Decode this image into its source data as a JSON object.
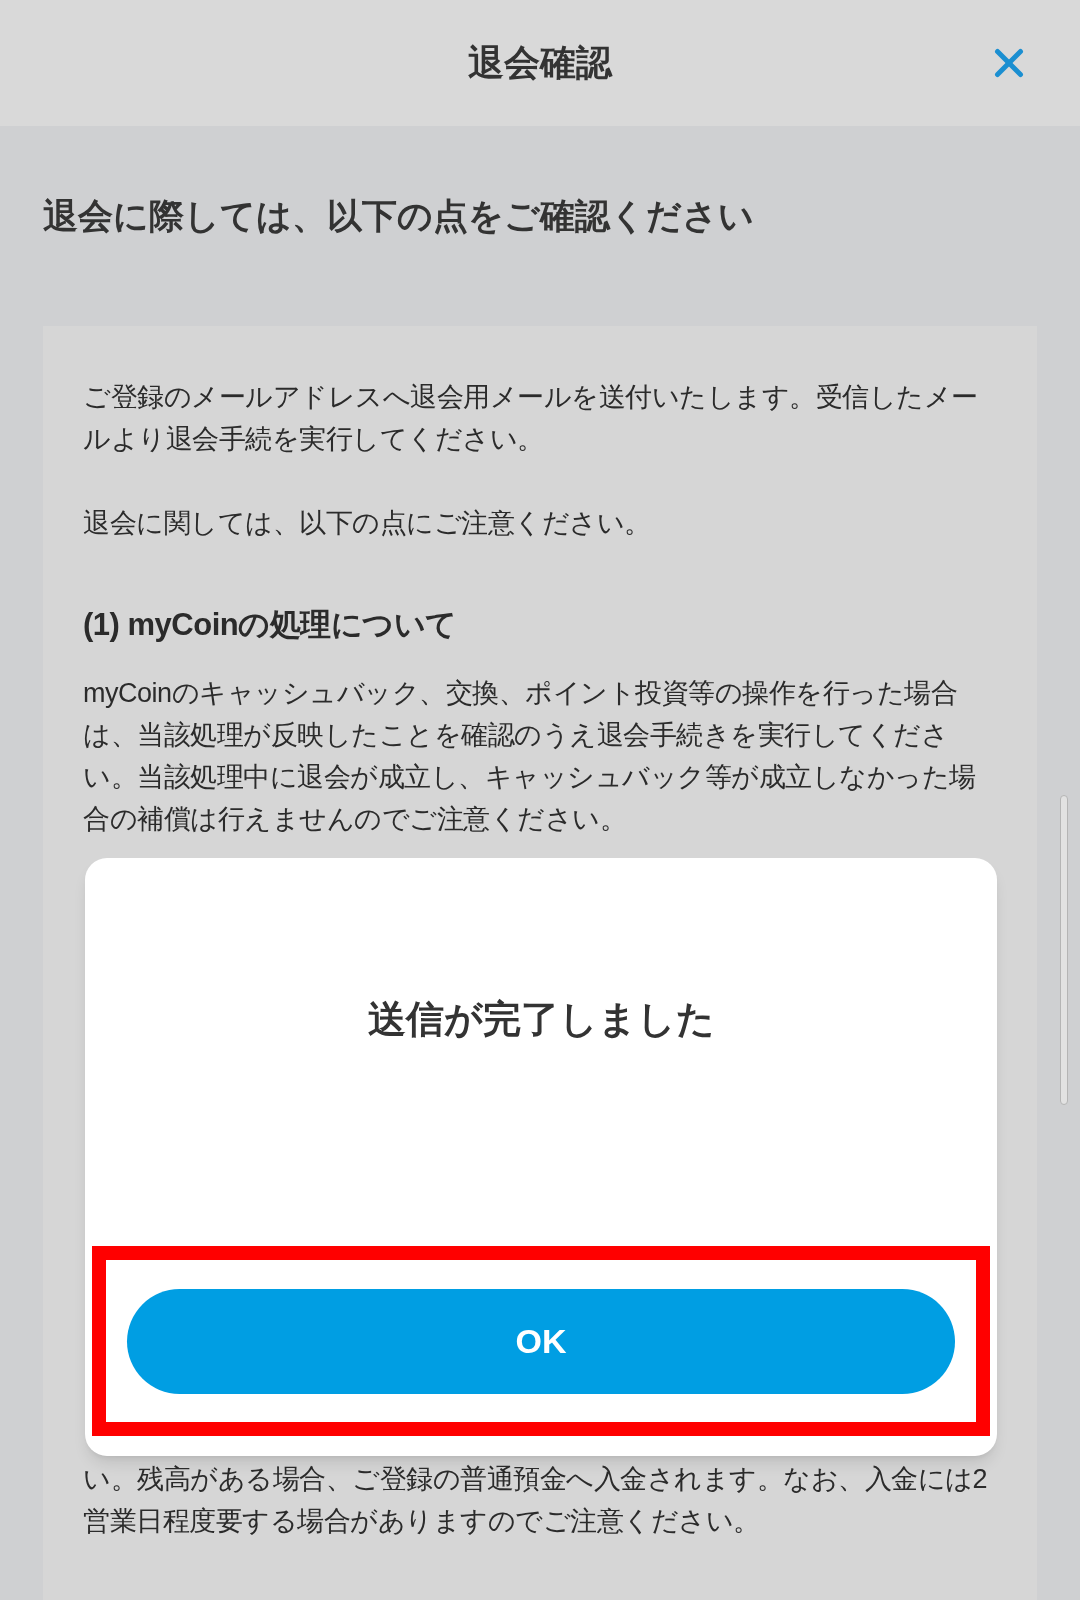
{
  "header": {
    "title": "退会確認"
  },
  "heading": "退会に際しては、以下の点をご確認ください",
  "notice": {
    "paragraphs": [
      "ご登録のメールアドレスへ退会用メールを送付いたします。受信したメールより退会手続を実行してください。",
      "退会に関しては、以下の点にご注意ください。"
    ],
    "section_title": "(1) myCoinの処理について",
    "section_body": "myCoinのキャッシュバック、交換、ポイント投資等の操作を行った場合は、当該処理が反映したことを確認のうえ退会手続きを実行してください。当該処理中に退会が成立し、キャッシュバック等が成立しなかった場合の補償は行えませんのでご注意ください。",
    "trailing_text": "い。残高がある場合、ご登録の普通預金へ入金されます。なお、入金には2営業日程度要する場合がありますのでご注意ください。"
  },
  "dialog": {
    "message": "送信が完了しました",
    "button": "OK",
    "highlighted": true
  }
}
